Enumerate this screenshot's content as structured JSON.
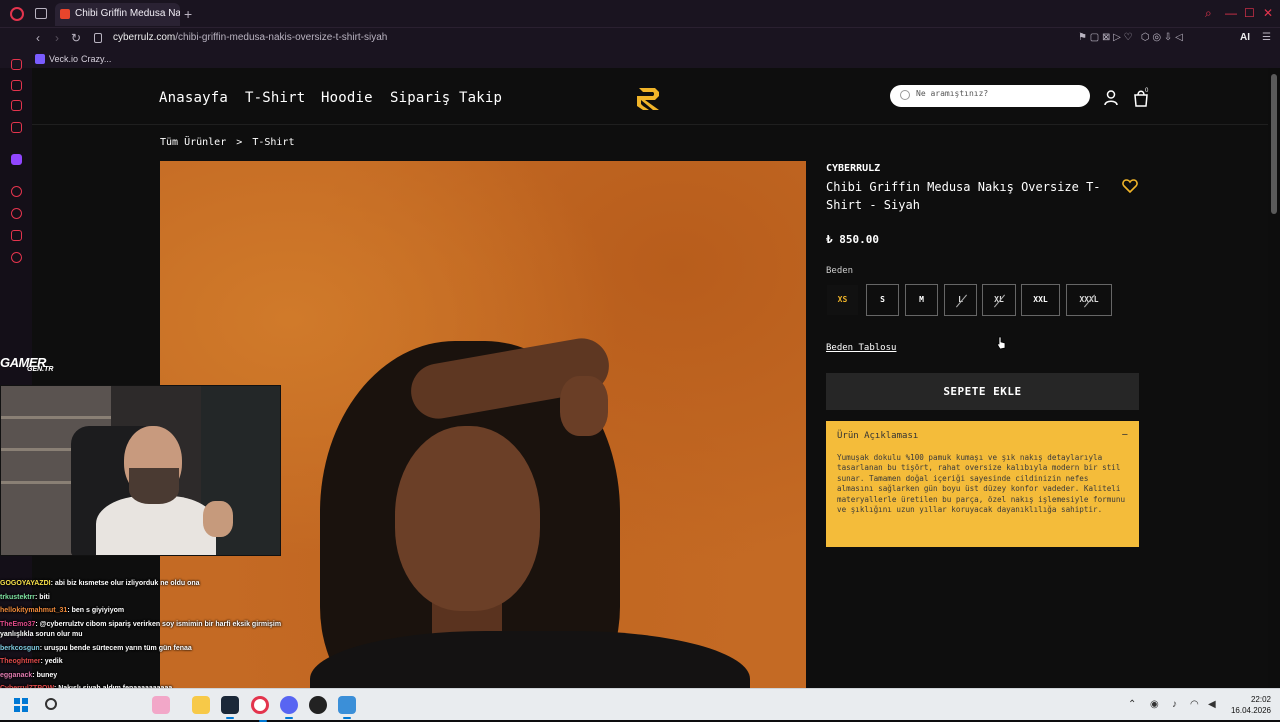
{
  "browser": {
    "tab_title": "Chibi Griffin Medusa Nakış",
    "new_tab": "+",
    "url_domain": "cyberrulz.com",
    "url_path": "/chibi-griffin-medusa-nakis-oversize-t-shirt-siyah",
    "bookmarks": [
      "Veck.io",
      "Crazy..."
    ]
  },
  "site": {
    "nav": [
      "Anasayfa",
      "T-Shirt",
      "Hoodie",
      "Sipariş Takip"
    ],
    "search_placeholder": "Ne aramıştınız?",
    "cart_count": "0",
    "breadcrumb": [
      "Tüm Ürünler",
      ">",
      "T-Shirt"
    ]
  },
  "product": {
    "brand": "CYBERRULZ",
    "title": "Chibi Griffin Medusa Nakış Oversize T-Shirt - Siyah",
    "price": "₺ 850.00",
    "size_label": "Beden",
    "sizes": [
      {
        "label": "XS",
        "state": "selected"
      },
      {
        "label": "S",
        "state": "available"
      },
      {
        "label": "M",
        "state": "available"
      },
      {
        "label": "L",
        "state": "disabled"
      },
      {
        "label": "XL",
        "state": "disabled"
      },
      {
        "label": "XXL",
        "state": "available"
      },
      {
        "label": "XXXL",
        "state": "disabled"
      }
    ],
    "size_table_link": "Beden Tablosu",
    "add_to_cart": "SEPETE EKLE",
    "description_title": "Ürün Açıklaması",
    "description_toggle": "−",
    "description": "Yumuşak dokulu %100 pamuk kumaşı ve şık nakış detaylarıyla tasarlanan bu tişört, rahat oversize kalıbıyla modern bir stil sunar. Tamamen doğal içeriği sayesinde cildinizin nefes almasını sağlarken gün boyu üst düzey konfor vadeder. Kaliteli materyallerle üretilen bu parça, özel nakış işlemesiyle formunu ve şıklığını uzun yıllar koruyacak dayanıklılığa sahiptir."
  },
  "overlay": {
    "gamer_logo": "GAMER",
    "gamer_sub": "GEN.TR",
    "chat": [
      {
        "user": "GOGOYAYAZDI",
        "color": "#f7e04a",
        "msg": ": abi biz kısmetse olur izliyorduk ne oldu ona"
      },
      {
        "user": "trkustektrr",
        "color": "#7ee0a0",
        "msg": ": biti"
      },
      {
        "user": "hellokitymahmut_31",
        "color": "#f08a3a",
        "msg": ": ben s giyiyiyom"
      },
      {
        "user": "TheEmo37",
        "color": "#e04a8a",
        "msg": ": @cyberrulztv cibom sipariş verirken soy ismimin bir harfi eksik girmişim"
      },
      {
        "user": "",
        "color": "#ffffff",
        "msg": "yanlışlıkla sorun olur mu"
      },
      {
        "user": "berkcosgun",
        "color": "#7ecbe0",
        "msg": ": uruşpu bende sürtecem yarın tüm gün fenaa"
      },
      {
        "user": "Theoghtmer",
        "color": "#e04a4a",
        "msg": ": yedik"
      },
      {
        "user": "egganack",
        "color": "#e07ab0",
        "msg": ": buney"
      },
      {
        "user": "CyberrulZTPOW",
        "color": "#e04a4a",
        "msg": ": Nakışlı siyah aldım fenaaaaaaaaaa"
      }
    ]
  },
  "taskbar": {
    "time": "22:02",
    "date": "16.04.2026"
  },
  "colors": {
    "accent_gold": "#f0b429",
    "description_bg": "#f4bc3a",
    "opera_red": "#e3344d"
  }
}
